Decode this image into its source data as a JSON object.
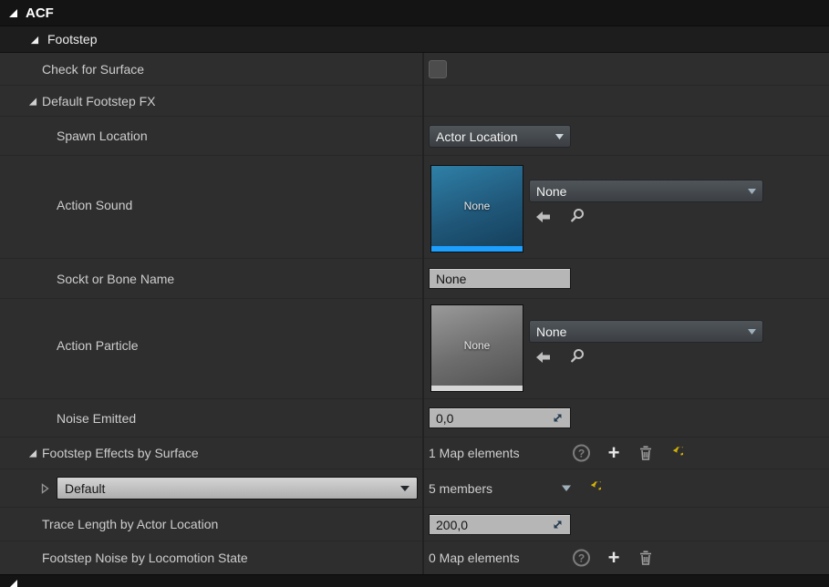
{
  "sections": {
    "acf": "ACF",
    "footstep": "Footstep"
  },
  "properties": {
    "check_for_surface": {
      "label": "Check for Surface",
      "checked": false
    },
    "default_footstep_fx": {
      "label": "Default Footstep FX"
    },
    "spawn_location": {
      "label": "Spawn Location",
      "value": "Actor Location"
    },
    "action_sound": {
      "label": "Action Sound",
      "thumbnail_label": "None",
      "asset": "None"
    },
    "sockt_or_bone_name": {
      "label": "Sockt or Bone Name",
      "value": "None"
    },
    "action_particle": {
      "label": "Action Particle",
      "thumbnail_label": "None",
      "asset": "None"
    },
    "noise_emitted": {
      "label": "Noise Emitted",
      "value": "0,0"
    },
    "footstep_effects_by_surface": {
      "label": "Footstep Effects by Surface",
      "summary": "1 Map elements"
    },
    "footstep_effects_element_0": {
      "key": "Default",
      "summary": "5 members"
    },
    "trace_length_by_actor_location": {
      "label": "Trace Length by Actor Location",
      "value": "200,0"
    },
    "footstep_noise_by_locomotion_state": {
      "label": "Footstep Noise by Locomotion State",
      "summary": "0 Map elements"
    }
  },
  "icons": {
    "help": "?",
    "add": "+",
    "delete": "trash-can",
    "reset_to_default": "yellow-undo-arrow",
    "use_selected_asset": "thick-left-arrow",
    "browse_to_asset": "magnifier",
    "dropdown": "triangle-down",
    "expander_expanded": "corner-triangle",
    "expander_collapsed": "triangle-right-outline",
    "expand_value": "diagonal-resize-arrows"
  },
  "colors": {
    "panel_background": "#2e2e2e",
    "header_background": "#141414",
    "sound_thumbnail_strip": "#1d9fff",
    "particle_thumbnail_strip": "#d6d6d6",
    "reset_arrow": "#d4b106"
  }
}
